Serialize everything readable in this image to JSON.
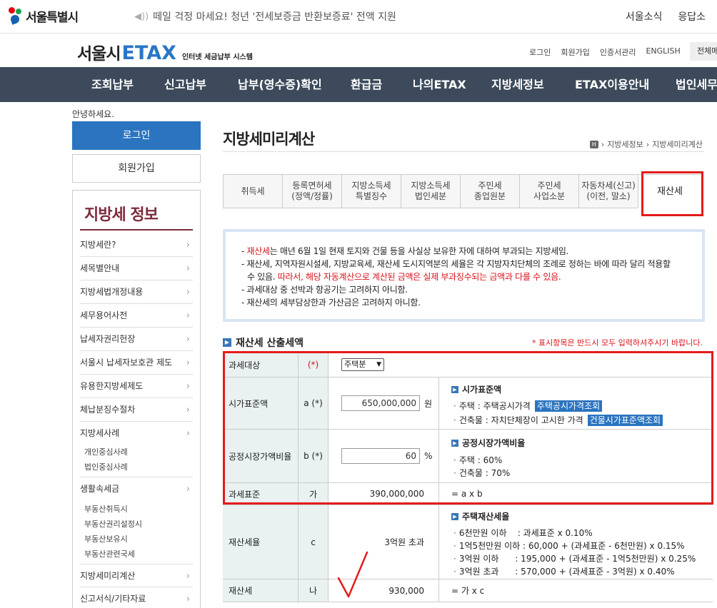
{
  "topbar": {
    "logo": "서울특별시",
    "notice": "떼일 걱정 마세요! 청년 '전세보증금 반환보증료' 전액 지원",
    "links": [
      "서울소식",
      "응답소"
    ]
  },
  "header": {
    "logo_a": "서울시",
    "logo_b": "ETAX",
    "logo_c": "인터넷 세금납부 시스템",
    "utils": [
      "로그인",
      "회원가입",
      "인증서관리",
      "ENGLISH"
    ],
    "search_stub": "전체메"
  },
  "nav": [
    "조회납부",
    "신고납부",
    "납부(영수증)확인",
    "환급금",
    "나의ETAX",
    "지방세정보",
    "ETAX이용안내",
    "법인세무"
  ],
  "sidebar": {
    "greeting": "안녕하세요.",
    "login": "로그인",
    "join": "회원가입",
    "title": "지방세 정보",
    "items": [
      "지방세란?",
      "세목별안내",
      "지방세법개정내용",
      "세무용어사전",
      "납세자권리헌장",
      "서울시 납세자보호관 제도",
      "유용한지방세제도",
      "체납분징수절차",
      "지방세사례"
    ],
    "sub1": [
      "개인중심사례",
      "법인중심사례"
    ],
    "item_life": "생활속세금",
    "sub2": [
      "부동산취득시",
      "부동산권리설정시",
      "부동산보유시",
      "부동산관련국세"
    ],
    "item_calc": "지방세미리계산",
    "item_forms": "신고서식/기타자료"
  },
  "main": {
    "title": "지방세미리계산",
    "breadcrumb": [
      "지방세정보",
      "지방세미리계산"
    ],
    "tabs": [
      {
        "l1": "취득세",
        "l2": ""
      },
      {
        "l1": "등록면허세",
        "l2": "(정액/정률)"
      },
      {
        "l1": "지방소득세",
        "l2": "특별징수"
      },
      {
        "l1": "지방소득세",
        "l2": "법인세분"
      },
      {
        "l1": "주민세",
        "l2": "종업원분"
      },
      {
        "l1": "주민세",
        "l2": "사업소분"
      },
      {
        "l1": "자동차세(신고)",
        "l2": "(이전, 말소)"
      },
      {
        "l1": "재산세",
        "l2": ""
      }
    ],
    "info": {
      "l1_red": "재산세",
      "l1_rest": "는 매년 6월 1일 현재 토지와 건물 등을 사실상 보유한 자에 대하여 부과되는 지방세임.",
      "l2": "재산세, 지역자원시설세, 지방교육세, 재산세 도시지역분의 세율은 각 지방자치단체의 조례로 정하는 바에 따라 달리 적용할",
      "l3_a": "수 있음. ",
      "l3_red": "따라서, 해당 자동계산으로 계산된 금액은 실제 부과징수되는 금액과 다를 수 있음.",
      "l4": "과세대상 중 선박과 항공기는 고려하지 아니함.",
      "l5": "재산세의 세부담상한과 가산금은 고려하지 아니함."
    },
    "section_title": "재산세 산출세액",
    "required_note": "* 표시항목은 반드시 모두 입력하셔주시기 바랍니다.",
    "rows": {
      "target": {
        "label": "과세대상",
        "mark": "(*)",
        "select": "주택분"
      },
      "base": {
        "label": "시가표준액",
        "mark": "a (*)",
        "value": "650,000,000",
        "unit": "원",
        "desc_title": "시가표준액",
        "d1": "주택 : 주택공시가격",
        "d1_btn": "주택공시가격조회",
        "d2": "건축물 : 자치단체장이 고시한 가격",
        "d2_btn": "건물시가표준액조회"
      },
      "ratio": {
        "label": "공정시장가액비율",
        "mark": "b (*)",
        "value": "60",
        "unit": "%",
        "desc_title": "공정시장가액비율",
        "d1": "주택 : 60%",
        "d2": "건축물 : 70%"
      },
      "std": {
        "label": "과세표준",
        "mark": "가",
        "value": "390,000,000",
        "formula": "= a x b"
      },
      "rate": {
        "label": "재산세율",
        "mark": "c",
        "value": "3억원 초과",
        "desc_title": "주택재산세율",
        "lines": [
          "6천만원 이하    : 과세표준 x 0.10%",
          "1억5천만원 이하 : 60,000 + (과세표준 - 6천만원) x 0.15%",
          "3억원 이하      : 195,000 + (과세표준 - 1억5천만원) x 0.25%",
          "3억원 초과      : 570,000 + (과세표준 - 3억원) x 0.40%"
        ]
      },
      "tax": {
        "label": "재산세",
        "mark": "나",
        "value": "930,000",
        "formula": "= 가 x c"
      }
    }
  },
  "colors": {
    "nav_bg": "#3c4a5b",
    "accent_blue": "#2b74bf",
    "highlight_red": "#e41b1b",
    "side_title": "#7d2a3c"
  }
}
